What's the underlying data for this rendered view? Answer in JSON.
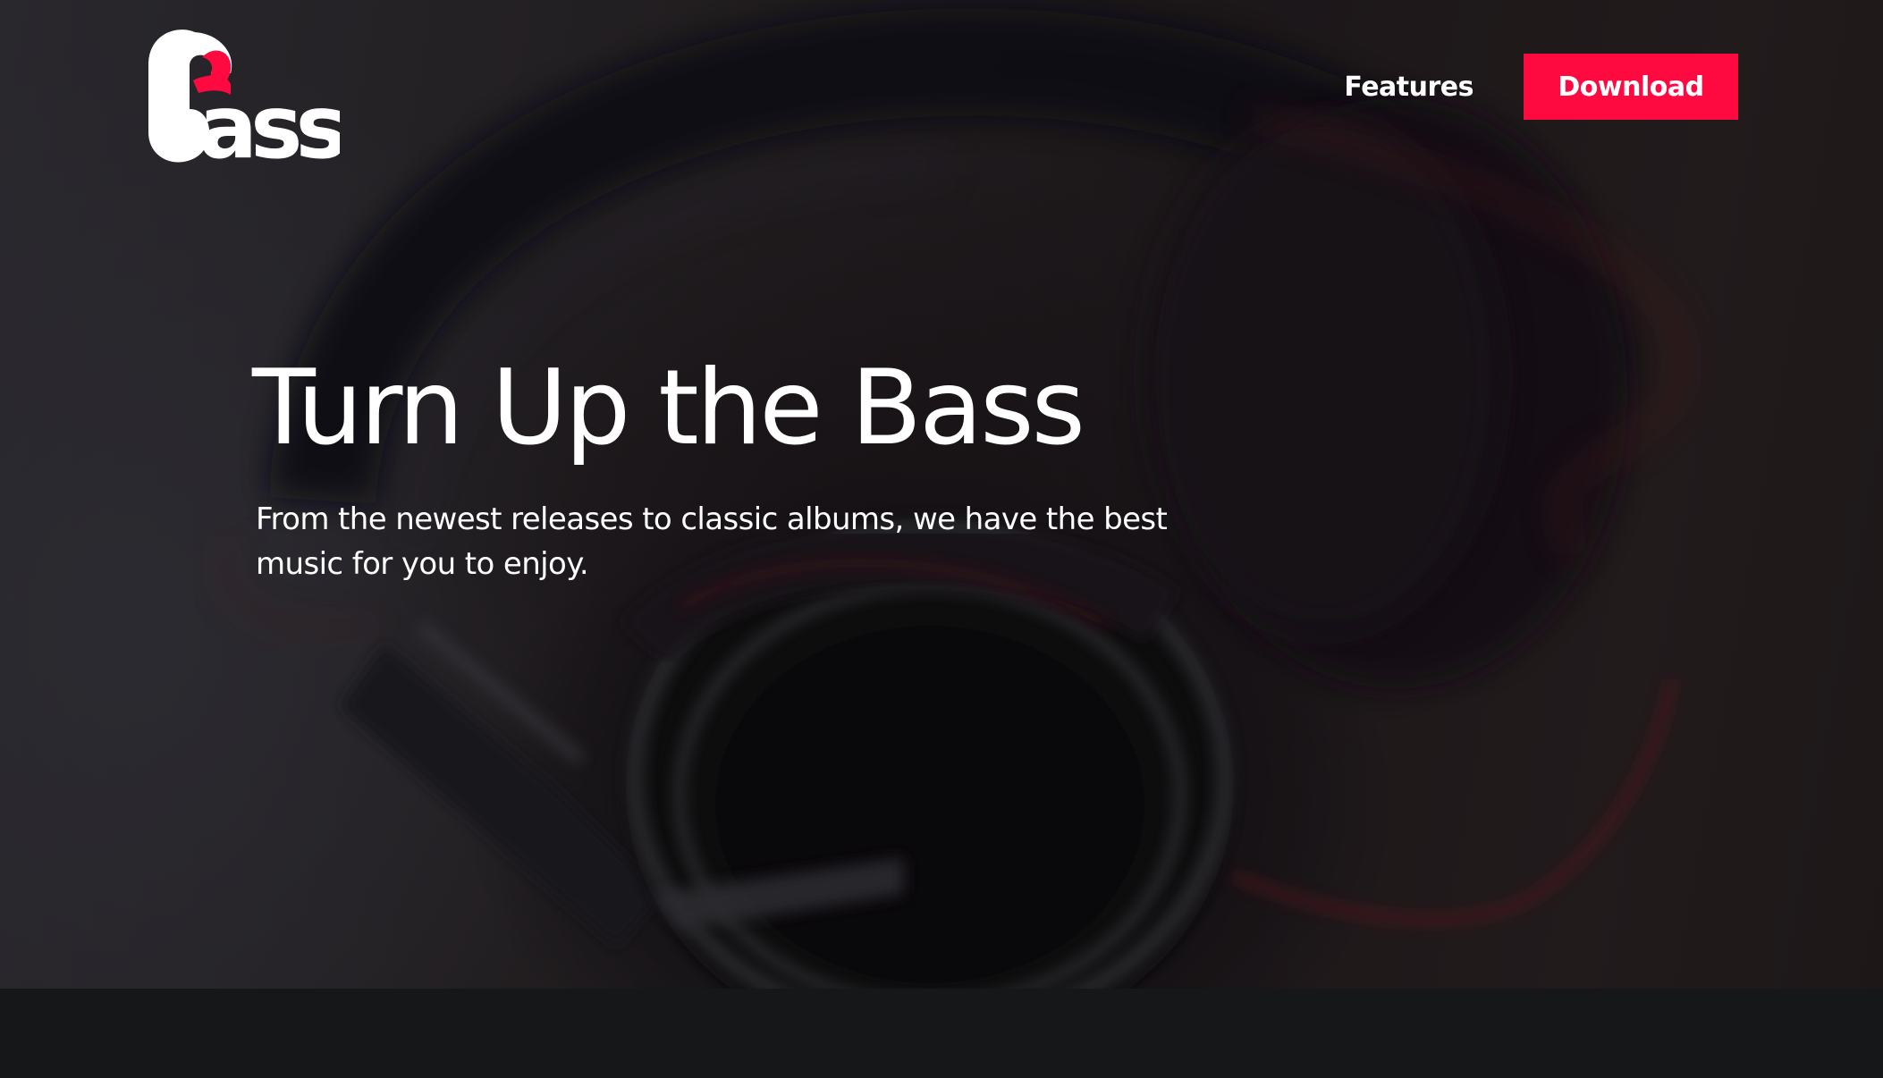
{
  "brand": {
    "logo_text": "bass",
    "logo_icon": "headphone-b-logo",
    "accent_color": "#ff0a40"
  },
  "nav": {
    "features_label": "Features",
    "download_label": "Download"
  },
  "hero": {
    "title": "Turn Up the Bass",
    "subtitle": "From the newest releases to classic albums, we have the best music for you to enjoy.",
    "background_image": "blurred headphones photo"
  },
  "colors": {
    "text": "#ffffff",
    "footer_bg": "#151719"
  }
}
